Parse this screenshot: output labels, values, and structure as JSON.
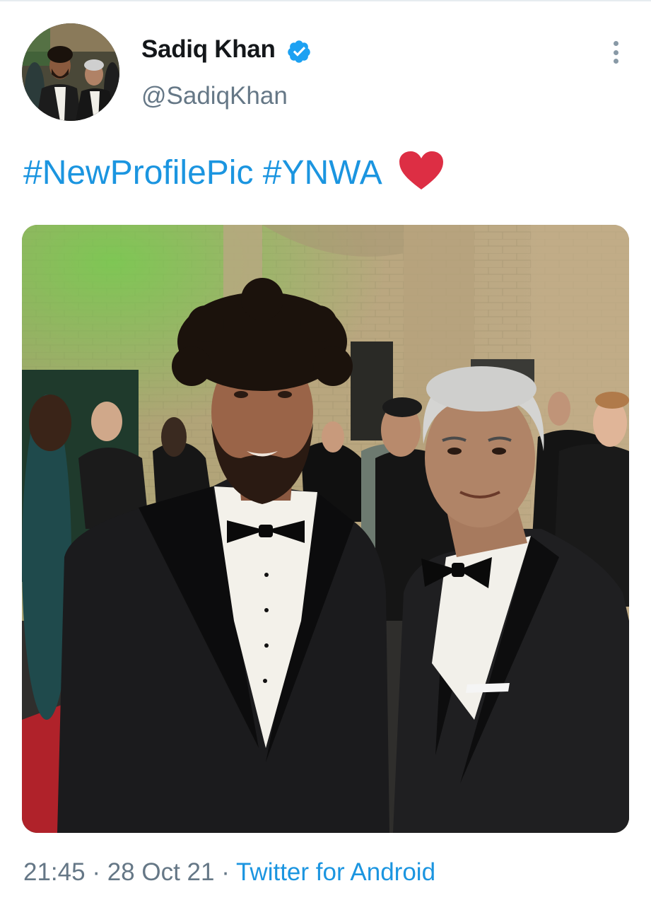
{
  "author": {
    "display_name": "Sadiq Khan",
    "handle": "@SadiqKhan",
    "verified": true,
    "avatar_icon": "profile-photo"
  },
  "tweet": {
    "hashtags": [
      "#NewProfilePic",
      "#YNWA"
    ],
    "emoji_icon": "red-heart-icon"
  },
  "media": {
    "type": "photo",
    "icon": "photo-two-men-in-tuxedos"
  },
  "meta": {
    "time": "21:45",
    "separator": "·",
    "date": "28 Oct 21",
    "source": "Twitter for Android"
  },
  "colors": {
    "link": "#1b95e0",
    "secondary_text": "#657786",
    "primary_text": "#14171a",
    "heart": "#e0245e"
  }
}
